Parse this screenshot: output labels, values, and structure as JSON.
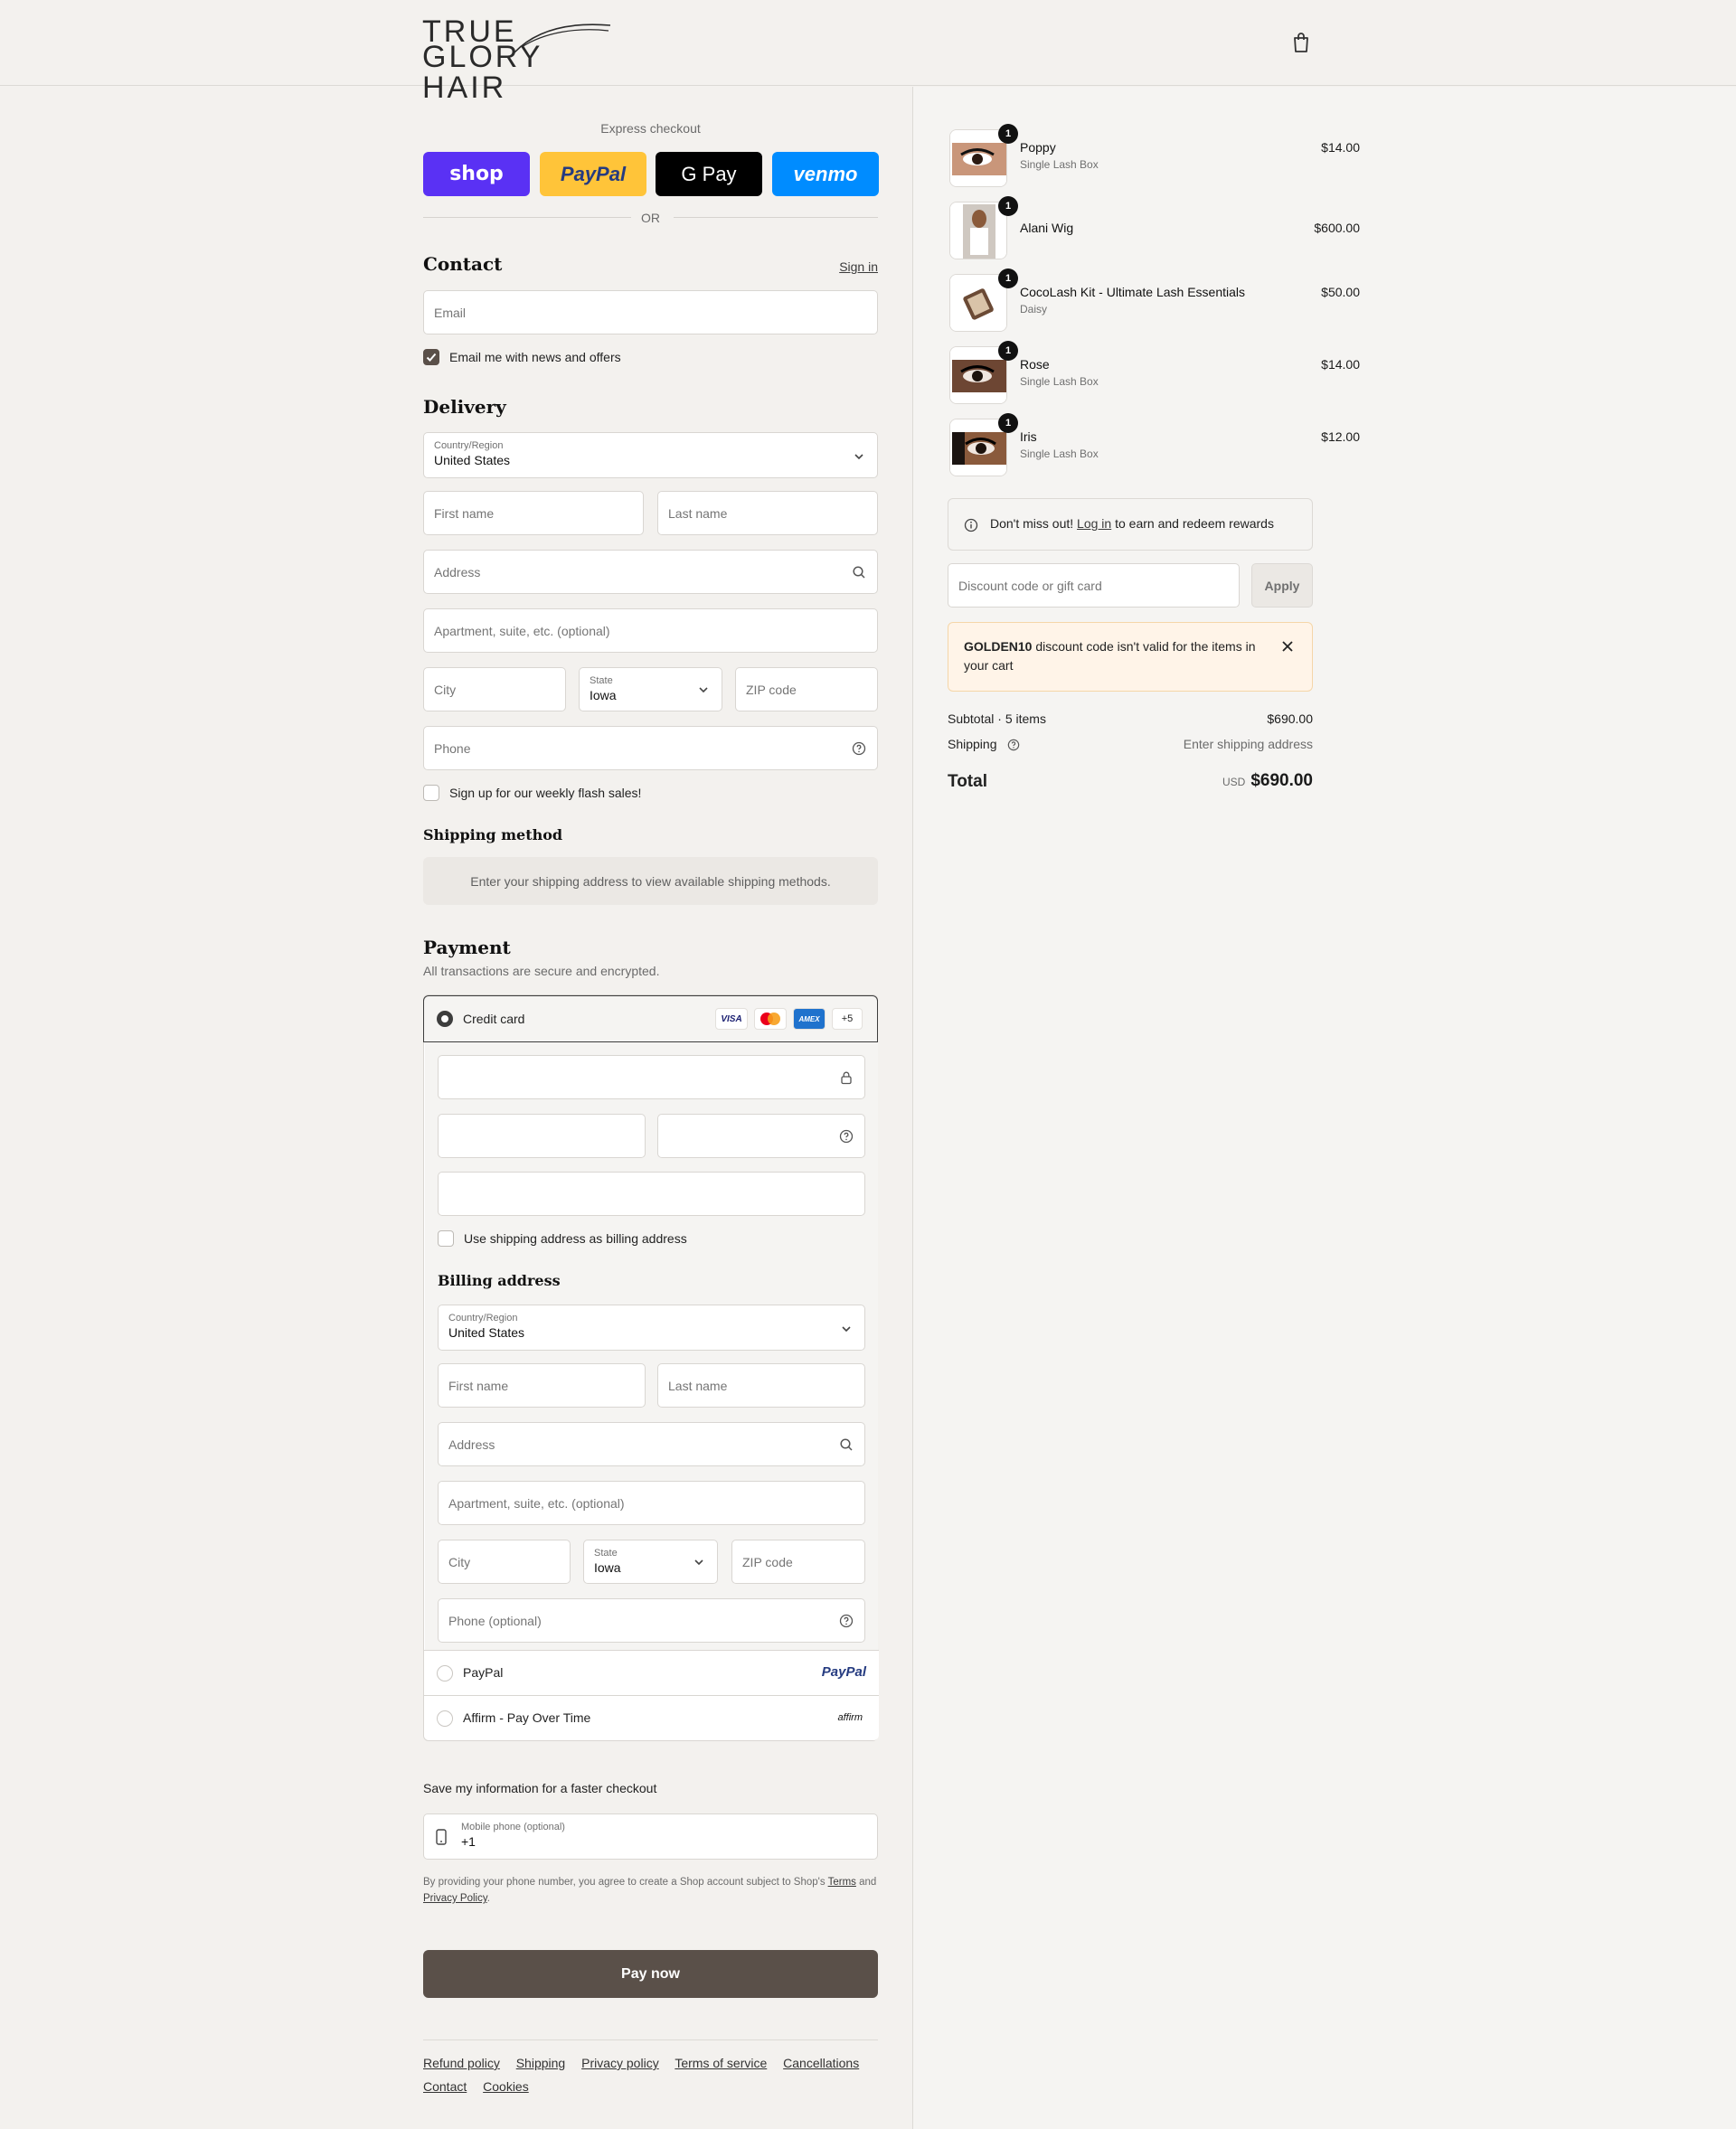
{
  "header": {
    "logo_line1": "TRUE",
    "logo_line2": "GLORY HAIR",
    "cart_icon": "shopping-bag-icon"
  },
  "express": {
    "title": "Express checkout",
    "buttons": [
      {
        "label": "shop",
        "color": "#5a31f4",
        "text_color": "#ffffff"
      },
      {
        "label": "PayPal",
        "color": "#ffc439",
        "text_color": "#253b80"
      },
      {
        "label": "G Pay",
        "color": "#000000",
        "text_color": "#ffffff"
      },
      {
        "label": "venmo",
        "color": "#008cff",
        "text_color": "#ffffff"
      }
    ],
    "or": "OR"
  },
  "contact": {
    "heading": "Contact",
    "sign_in": "Sign in",
    "email_placeholder": "Email",
    "news_label": "Email me with news and offers",
    "news_checked": true
  },
  "delivery": {
    "heading": "Delivery",
    "country_label": "Country/Region",
    "country_value": "United States",
    "first_name": "First name",
    "last_name": "Last name",
    "address": "Address",
    "apartment": "Apartment, suite, etc. (optional)",
    "city": "City",
    "state_label": "State",
    "state_value": "Iowa",
    "zip": "ZIP code",
    "phone": "Phone",
    "flash_label": "Sign up for our weekly flash sales!"
  },
  "shipping_method": {
    "heading": "Shipping method",
    "notice": "Enter your shipping address to view available shipping methods."
  },
  "payment": {
    "heading": "Payment",
    "subtitle": "All transactions are secure and encrypted.",
    "credit_card_label": "Credit card",
    "card_icons": [
      "VISA",
      "mastercard",
      "AMEX",
      "+5"
    ],
    "billing_same_label": "Use shipping address as billing address",
    "billing_heading": "Billing address",
    "billing": {
      "country_label": "Country/Region",
      "country_value": "United States",
      "first_name": "First name",
      "last_name": "Last name",
      "address": "Address",
      "apartment": "Apartment, suite, etc. (optional)",
      "city": "City",
      "state_label": "State",
      "state_value": "Iowa",
      "zip": "ZIP code",
      "phone": "Phone (optional)"
    },
    "paypal_label": "PayPal",
    "paypal_logo": "PayPal",
    "affirm_label": "Affirm - Pay Over Time",
    "affirm_logo": "affirm"
  },
  "save_info": {
    "heading": "Save my information for a faster checkout",
    "mobile_label": "Mobile phone (optional)",
    "mobile_value": "+1",
    "terms_prefix": "By providing your phone number, you agree to create a Shop account subject to Shop's",
    "terms_link": "Terms",
    "and": "and",
    "privacy_link": "Privacy Policy",
    "period": "."
  },
  "pay_now": "Pay now",
  "footer_links": [
    "Refund policy",
    "Shipping",
    "Privacy policy",
    "Terms of service",
    "Cancellations",
    "Contact",
    "Cookies"
  ],
  "cart": {
    "items": [
      {
        "name": "Poppy",
        "variant": "Single Lash Box",
        "price": "$14.00",
        "qty": "1"
      },
      {
        "name": "Alani Wig",
        "variant": "",
        "price": "$600.00",
        "qty": "1"
      },
      {
        "name": "CocoLash Kit - Ultimate Lash Essentials",
        "variant": "Daisy",
        "price": "$50.00",
        "qty": "1"
      },
      {
        "name": "Rose",
        "variant": "Single Lash Box",
        "price": "$14.00",
        "qty": "1"
      },
      {
        "name": "Iris",
        "variant": "Single Lash Box",
        "price": "$12.00",
        "qty": "1"
      }
    ],
    "rewards_prefix": "Don't miss out!",
    "rewards_link": "Log in",
    "rewards_suffix": "to earn and redeem rewards",
    "discount_placeholder": "Discount code or gift card",
    "apply": "Apply",
    "error_code": "GOLDEN10",
    "error_text": "discount code isn't valid for the items in your cart",
    "subtotal_label": "Subtotal · 5 items",
    "subtotal_value": "$690.00",
    "shipping_label": "Shipping",
    "shipping_value": "Enter shipping address",
    "total_label": "Total",
    "total_currency": "USD",
    "total_value": "$690.00"
  }
}
